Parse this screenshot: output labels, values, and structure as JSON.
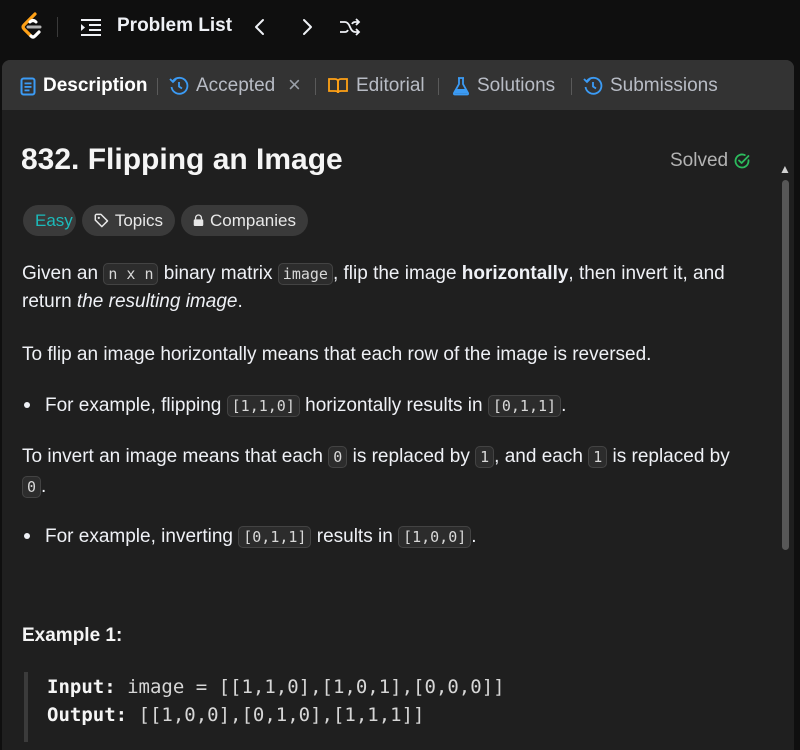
{
  "nav": {
    "problem_list_label": "Problem List"
  },
  "tabs": [
    {
      "label": "Description"
    },
    {
      "label": "Accepted"
    },
    {
      "label": "Editorial"
    },
    {
      "label": "Solutions"
    },
    {
      "label": "Submissions"
    }
  ],
  "tab_close_glyph": "×",
  "problem": {
    "title": "832. Flipping an Image",
    "solved_label": "Solved",
    "difficulty": "Easy",
    "topics_label": "Topics",
    "companies_label": "Companies"
  },
  "description": {
    "p1": {
      "a": "Given an ",
      "code1": "n x n",
      "b": " binary matrix ",
      "code2": "image",
      "c": ", flip the image ",
      "bold": "horizontally",
      "d": ", then invert it, and",
      "e": "return ",
      "italic": "the resulting image",
      "f": "."
    },
    "p2": "To flip an image horizontally means that each row of the image is reversed.",
    "b1": {
      "a": "For example, flipping ",
      "code1": "[1,1,0]",
      "b": " horizontally results in ",
      "code2": "[0,1,1]",
      "c": "."
    },
    "p3": {
      "a": "To invert an image means that each ",
      "code1": "0",
      "b": " is replaced by ",
      "code2": "1",
      "c": ", and each ",
      "code3": "1",
      "d": " is replaced by",
      "code4": "0",
      "e": "."
    },
    "b2": {
      "a": "For example, inverting ",
      "code1": "[0,1,1]",
      "b": " results in ",
      "code2": "[1,0,0]",
      "c": "."
    }
  },
  "example1": {
    "title": "Example 1:",
    "input_label": "Input:",
    "input_value": " image = [[1,1,0],[1,0,1],[0,0,0]]",
    "output_label": "Output:",
    "output_value": " [[1,0,0],[0,1,0],[1,1,1]]"
  },
  "colors": {
    "easy": "#1cbaba",
    "solved_check": "#2cbb5d",
    "description_icon": "#3b9bf5",
    "logo_orange": "#ffa116"
  }
}
